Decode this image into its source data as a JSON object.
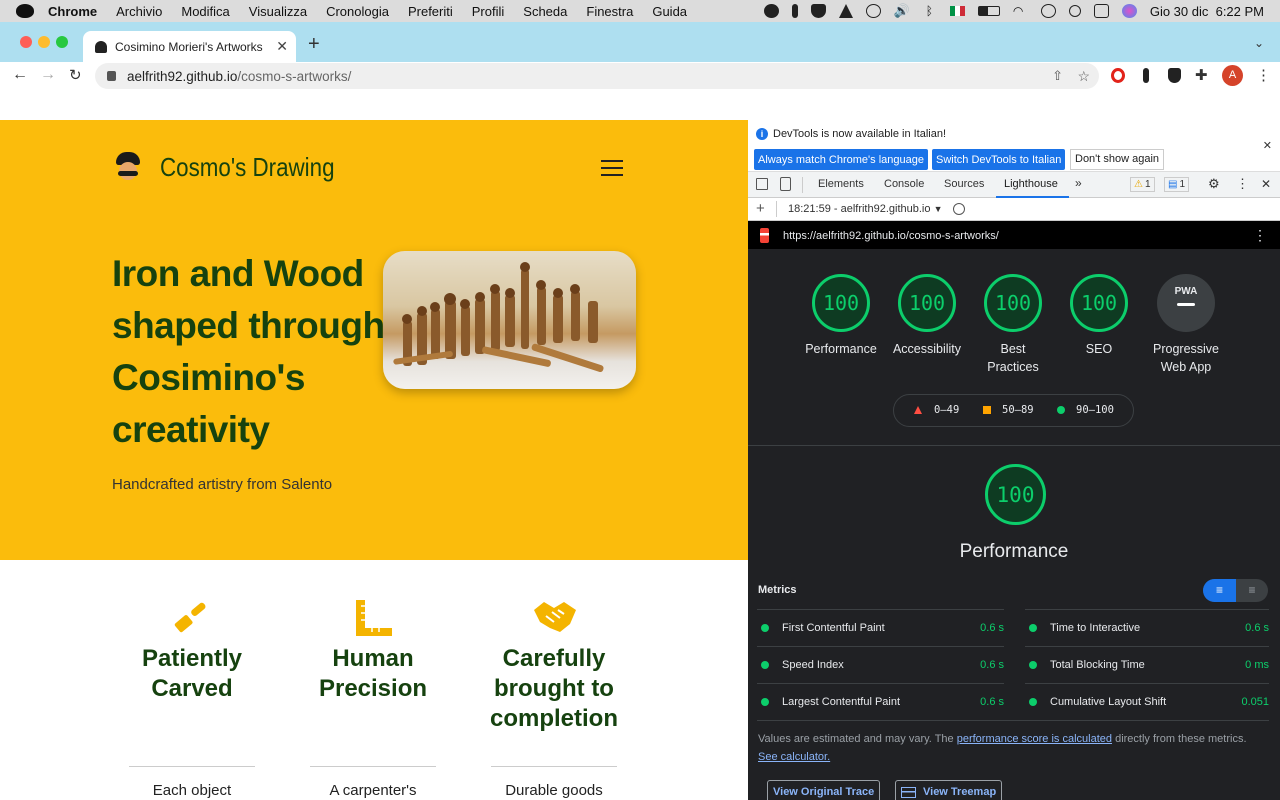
{
  "menubar": {
    "items": [
      "Chrome",
      "Archivio",
      "Modifica",
      "Visualizza",
      "Cronologia",
      "Preferiti",
      "Profili",
      "Scheda",
      "Finestra",
      "Guida"
    ],
    "clock": "Gio 30 dic  6:22 PM"
  },
  "browser": {
    "tab_title": "Cosimino Morieri's Artworks",
    "url_domain": "aelfrith92.github.io",
    "url_path": "/cosmo-s-artworks/",
    "profile_initial": "A"
  },
  "site": {
    "brand": "Cosmo's Drawing",
    "hero_title": "Iron and Wood shaped through Cosimino's creativity",
    "hero_subtitle": "Handcrafted artistry from Salento",
    "features": [
      {
        "title": "Patiently Carved",
        "desc": "Each object"
      },
      {
        "title": "Human Precision",
        "desc": "A carpenter's"
      },
      {
        "title": "Carefully brought to completion",
        "desc": "Durable goods"
      }
    ]
  },
  "devtools": {
    "info_text": "DevTools is now available in Italian!",
    "btn_match": "Always match Chrome's language",
    "btn_switch": "Switch DevTools to Italian",
    "btn_dont": "Don't show again",
    "tabs": [
      "Elements",
      "Console",
      "Sources",
      "Lighthouse"
    ],
    "active_tab": "Lighthouse",
    "warn_count": "1",
    "msg_count": "1",
    "report_time": "18:21:59 - aelfrith92.github.io",
    "report_url": "https://aelfrith92.github.io/cosmo-s-artworks/",
    "scores": [
      {
        "value": "100",
        "label": "Performance"
      },
      {
        "value": "100",
        "label": "Accessibility"
      },
      {
        "value": "100",
        "label": "Best Practices"
      },
      {
        "value": "100",
        "label": "SEO"
      }
    ],
    "pwa_badge": "PWA",
    "pwa_label": "Progressive Web App",
    "legend": [
      "0–49",
      "50–89",
      "90–100"
    ],
    "perf_score": "100",
    "perf_title": "Performance",
    "metrics_heading": "Metrics",
    "metrics": [
      {
        "name": "First Contentful Paint",
        "value": "0.6 s"
      },
      {
        "name": "Time to Interactive",
        "value": "0.6 s"
      },
      {
        "name": "Speed Index",
        "value": "0.6 s"
      },
      {
        "name": "Total Blocking Time",
        "value": "0 ms"
      },
      {
        "name": "Largest Contentful Paint",
        "value": "0.6 s"
      },
      {
        "name": "Cumulative Layout Shift",
        "value": "0.051"
      }
    ],
    "note_prefix": "Values are estimated and may vary. The",
    "note_link1": "performance score is calculated",
    "note_middle": "directly from these metrics.",
    "note_link2": "See calculator.",
    "btn_trace": "View Original Trace",
    "btn_treemap": "View Treemap"
  },
  "colors": {
    "hero_bg": "#fbbc0c",
    "brand_green": "#16420f",
    "pass_green": "#0cce6b"
  }
}
